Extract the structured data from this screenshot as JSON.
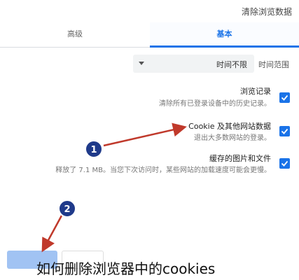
{
  "dialog": {
    "title": "清除浏览数据"
  },
  "tabs": [
    {
      "label": "基本",
      "active": true
    },
    {
      "label": "高级",
      "active": false
    }
  ],
  "time_range": {
    "label": "时间范围",
    "value": "时间不限"
  },
  "options": [
    {
      "title": "浏览记录",
      "description": "清除所有已登录设备中的历史记录。",
      "checked": true
    },
    {
      "title": "Cookie 及其他网站数据",
      "description": "退出大多数网站的登录。",
      "checked": true
    },
    {
      "title": "缓存的图片和文件",
      "description": "释放了 7.1 MB。当您下次访问时，某些网站的加载速度可能会更慢。",
      "checked": true
    }
  ],
  "annotations": [
    {
      "label": "1"
    },
    {
      "label": "2"
    }
  ],
  "caption": "如何删除浏览器中的cookies",
  "colors": {
    "accent": "#1a73e8",
    "annotation_arrow": "#c0392b",
    "annotation_badge": "#1f3a8a"
  }
}
